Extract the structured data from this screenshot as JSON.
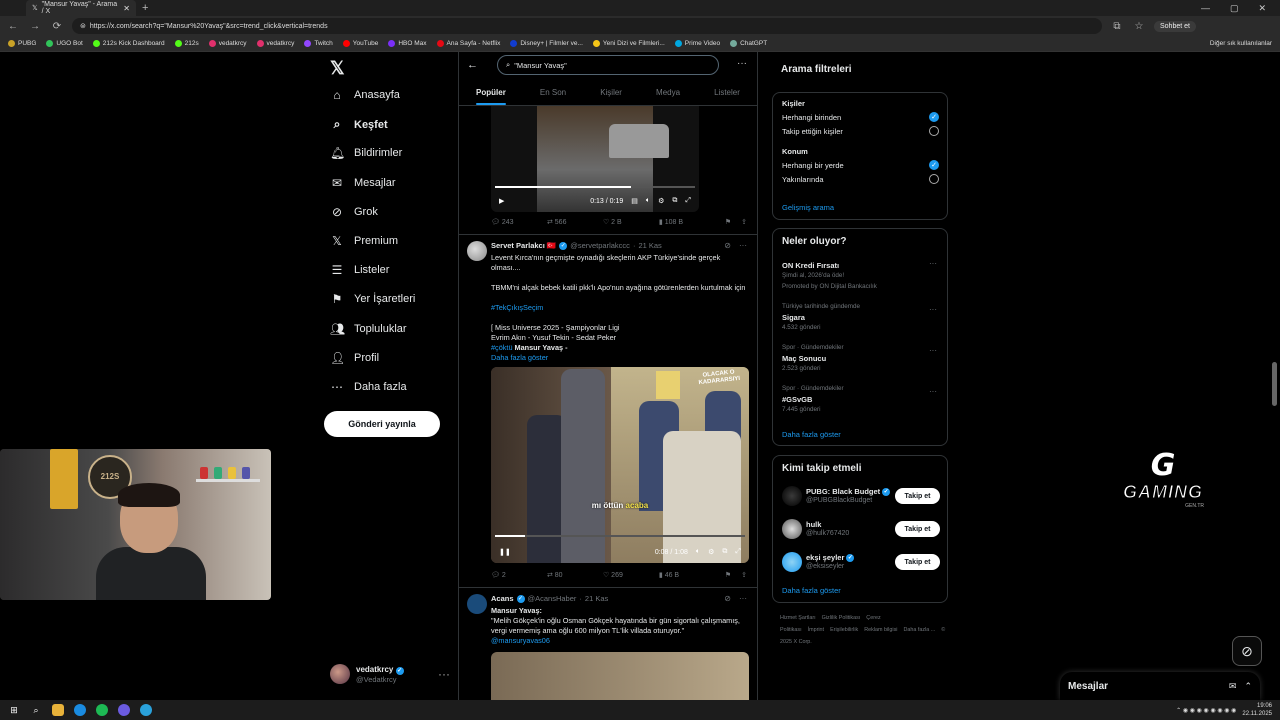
{
  "browser": {
    "tab_title": "\"Mansur Yavaş\" - Arama / X",
    "url": "https://x.com/search?q=\"Mansur%20Yavaş\"&src=trend_click&vertical=trends",
    "profile_button": "Sohbet et",
    "bookmarks": [
      "PUBG",
      "UGO Bot",
      "212s Kick Dashboard",
      "212s",
      "vedatkrcy",
      "vedatkrcy",
      "Twitch",
      "YouTube",
      "HBO Max",
      "Ana Sayfa - Netflix",
      "Disney+ | Filmler ve...",
      "Yeni Dizi ve Filmleri...",
      "Prime Video",
      "ChatGPT"
    ],
    "other_bookmarks": "Diğer sık kullanılanlar"
  },
  "leftnav": {
    "items": [
      {
        "label": "Anasayfa",
        "icon": "home-icon"
      },
      {
        "label": "Keşfet",
        "icon": "search-icon"
      },
      {
        "label": "Bildirimler",
        "icon": "bell-icon"
      },
      {
        "label": "Mesajlar",
        "icon": "mail-icon"
      },
      {
        "label": "Grok",
        "icon": "grok-icon"
      },
      {
        "label": "Premium",
        "icon": "x-icon"
      },
      {
        "label": "Listeler",
        "icon": "list-icon"
      },
      {
        "label": "Yer İşaretleri",
        "icon": "bookmark-icon"
      },
      {
        "label": "Topluluklar",
        "icon": "people-icon"
      },
      {
        "label": "Profil",
        "icon": "person-icon"
      },
      {
        "label": "Daha fazla",
        "icon": "more-icon"
      }
    ],
    "post_button": "Gönderi yayınla",
    "account": {
      "name": "vedatkrcy",
      "handle": "@Vedatkrcy"
    }
  },
  "search": {
    "query": "\"Mansur Yavaş\"",
    "tabs": [
      "Popüler",
      "En Son",
      "Kişiler",
      "Medya",
      "Listeler"
    ]
  },
  "feed": {
    "video1": {
      "time": "0:13 / 0:19",
      "progress": 0.68,
      "replies": "243",
      "reposts": "566",
      "likes": "2 B",
      "views": "108 B"
    },
    "tweet2": {
      "name": "Servet Parlakcı 🇹🇷",
      "handle": "@servetparlakccc",
      "date": "21 Kas",
      "line1": "Levent Kırca'nın geçmişte oynadığı skeçlerin AKP Türkiye'sinde gerçek olması....",
      "line2": "TBMM'ni alçak bebek katili pkk'lı Apo'nun ayağına götürenlerden kurtulmak için",
      "hashtag1": "#TekÇıkışSeçim",
      "line3": "[ Miss Universe 2025 - Şampiyonlar Ligi",
      "line4": "Evrim Akın - Yusuf Tekin - Sedat Peker",
      "hashtag2": "#çöktü",
      "mention_text": "Mansur Yavaş -",
      "show_more": "Daha fazla göster",
      "video_banner": "OLACAK O KADARARSIYI",
      "video_subtitle_a": "mı öttün",
      "video_subtitle_b": "acaba",
      "video_time": "0:08 / 1:08",
      "video_progress": 0.12,
      "replies": "2",
      "reposts": "80",
      "likes": "269",
      "views": "46 B"
    },
    "tweet3": {
      "name": "Acans",
      "handle": "@AcansHaber",
      "date": "21 Kas",
      "line1": "Mansur Yavaş:",
      "line2": "\"Melih Gökçek'in oğlu Osman Gökçek hayatında bir gün sigortalı çalışmamış, vergi vermemiş ama oğlu 600 milyon TL'lik villada oturuyor.\"",
      "mention": "@mansuryavas06"
    }
  },
  "filters": {
    "title": "Arama filtreleri",
    "people_label": "Kişiler",
    "people_options": [
      "Herhangi birinden",
      "Takip ettiğin kişiler"
    ],
    "location_label": "Konum",
    "location_options": [
      "Herhangi bir yerde",
      "Yakınlarında"
    ],
    "advanced": "Gelişmiş arama"
  },
  "trends": {
    "title": "Neler oluyor?",
    "promoted": {
      "name": "ON Kredi Fırsatı",
      "sub": "Şimdi al, 2026'da öde!",
      "promo": "Promoted by ON Dijital Bankacılık"
    },
    "items": [
      {
        "meta": "Türkiye tarihinde gündemde",
        "name": "Sigara",
        "count": "4.532 gönderi"
      },
      {
        "meta": "Spor · Gündemdekiler",
        "name": "Maç Sonucu",
        "count": "2.523 gönderi"
      },
      {
        "meta": "Spor · Gündemdekiler",
        "name": "#GSvGB",
        "count": "7.445 gönderi"
      }
    ],
    "show_more": "Daha fazla göster"
  },
  "who_to_follow": {
    "title": "Kimi takip etmeli",
    "accounts": [
      {
        "name": "PUBG: Black Budget",
        "handle": "@PUBGBlackBudget"
      },
      {
        "name": "hulk",
        "handle": "@hulk767420"
      },
      {
        "name": "ekşi şeyler",
        "handle": "@eksiseyler"
      }
    ],
    "follow_label": "Takip et",
    "show_more": "Daha fazla göster"
  },
  "footer": [
    "Hizmet Şartları",
    "Gizlilik Politikası",
    "Çerez Politikası",
    "İmprint",
    "Erişilebilirlik",
    "Reklam bilgisi",
    "Daha fazla ...",
    "© 2025 X Corp."
  ],
  "overlay": {
    "cam_logo": "212S",
    "gaming_text": "GAMING",
    "gaming_sub": "GEN.TR"
  },
  "messages": {
    "title": "Mesajlar"
  },
  "taskbar": {
    "time": "19:06",
    "date": "22.11.2025"
  }
}
